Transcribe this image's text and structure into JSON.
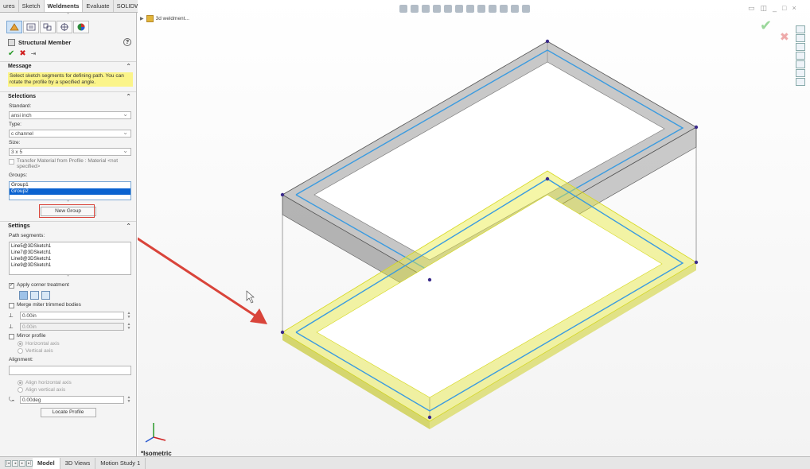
{
  "command_tabs": [
    "ures",
    "Sketch",
    "Weldments",
    "Evaluate",
    "SOLIDWORKS Add-Ins"
  ],
  "active_tab": "Weldments",
  "panel": {
    "title": "Structural Member",
    "help_glyph": "?",
    "message_header": "Message",
    "message_text": "Select sketch segments for defining path. You can rotate the profile by a specified angle.",
    "selections_header": "Selections",
    "standard_label": "Standard:",
    "standard_value": "ansi inch",
    "type_label": "Type:",
    "type_value": "c channel",
    "size_label": "Size:",
    "size_value": "3 x 5",
    "transfer_material_label": "Transfer Material from Profile : Material <not specified>",
    "groups_label": "Groups:",
    "groups": [
      "Group1",
      "Group2"
    ],
    "selected_group": "Group2",
    "new_group_button": "New Group",
    "settings_header": "Settings",
    "path_segments_label": "Path segments:",
    "path_segments": [
      "Line5@3DSketch1",
      "Line7@3DSketch1",
      "Line8@3DSketch1",
      "Line9@3DSketch1"
    ],
    "apply_corner_label": "Apply corner treatment",
    "merge_miter_label": "Merge miter trimmed bodies",
    "gap1_value": "0.00in",
    "gap2_value": "0.00in",
    "mirror_profile_label": "Mirror profile",
    "horizontal_axis_label": "Horizontal axis",
    "vertical_axis_label": "Vertical axis",
    "alignment_label": "Alignment:",
    "align_horizontal_label": "Align horizontal axis",
    "align_vertical_label": "Align vertical axis",
    "rotation_value": "0.00deg",
    "locate_profile_button": "Locate Profile"
  },
  "viewport": {
    "tree_item": "3d weldment...",
    "view_label": "*Isometric"
  },
  "bottom_tabs": [
    "Model",
    "3D Views",
    "Motion Study 1"
  ],
  "active_bottom_tab": "Model",
  "colors": {
    "accent_blue": "#3a9be0",
    "highlight_yellow": "#e8ec3c",
    "annotation_red": "#d9443a",
    "message_yellow": "#fbf489"
  }
}
